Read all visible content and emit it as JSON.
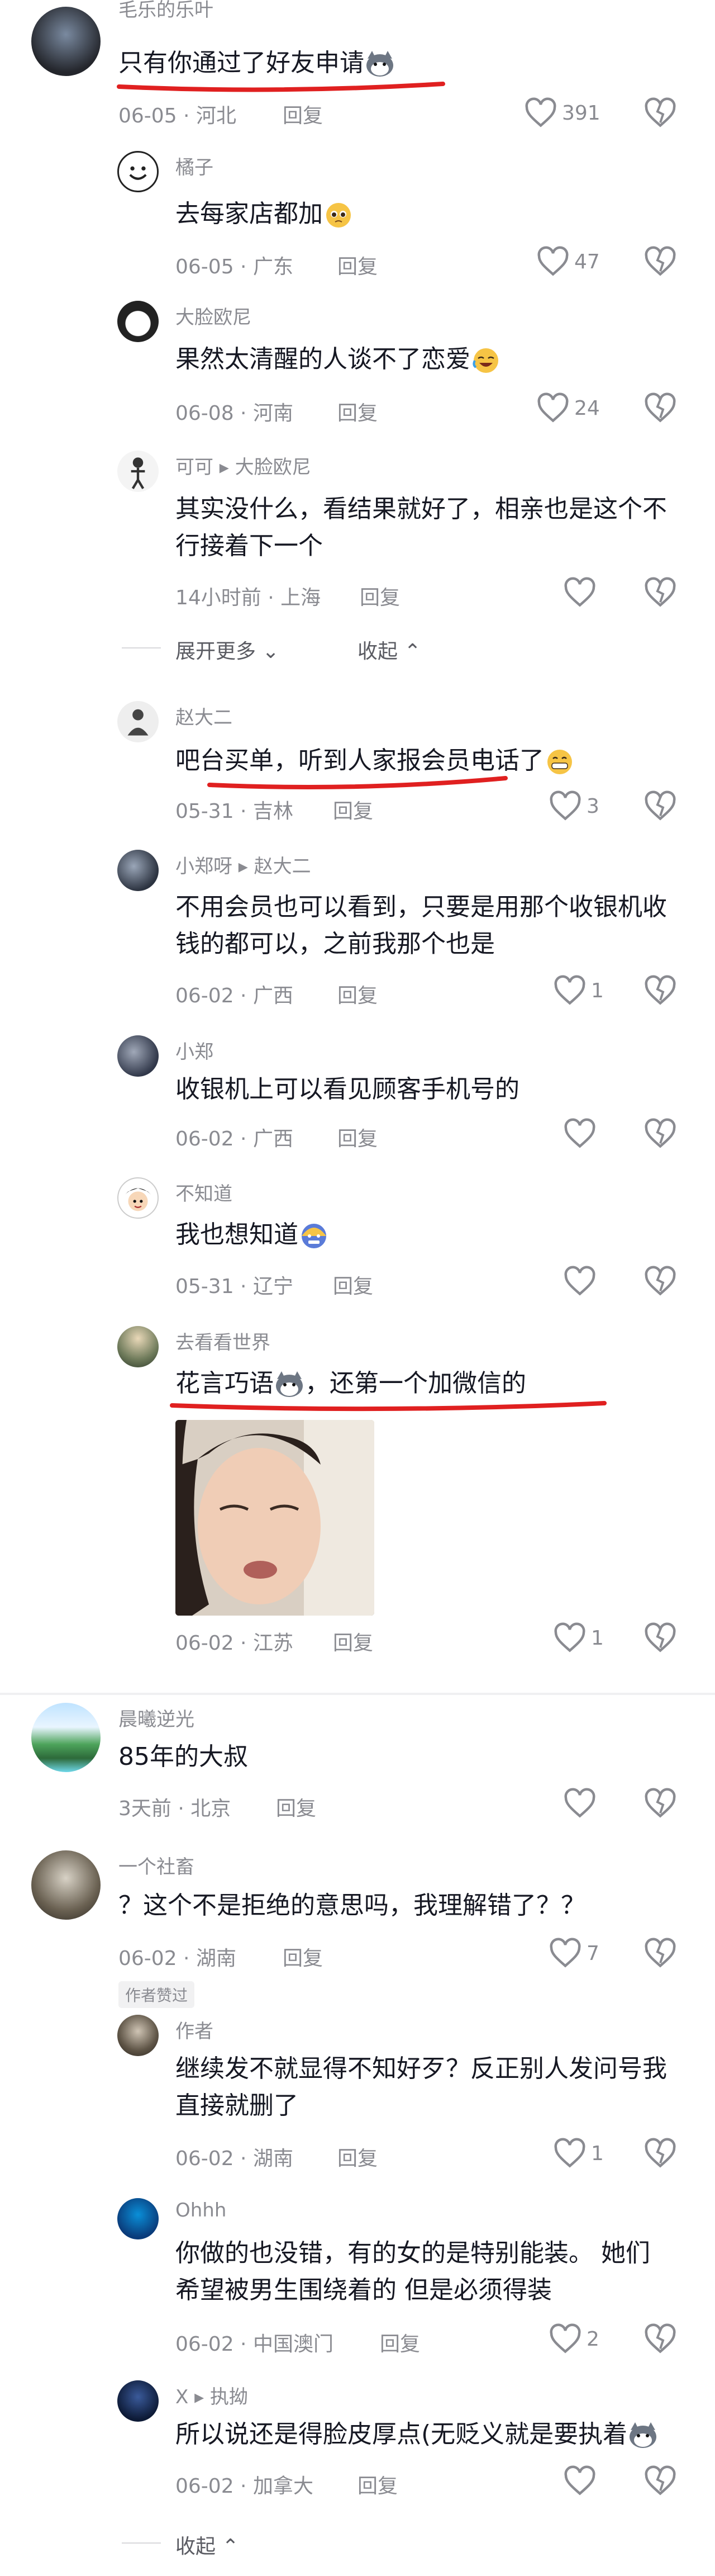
{
  "comments": [
    {
      "username": "毛乐的乐叶",
      "text": "只有你通过了好友申请",
      "date": "06-05",
      "location": "河北",
      "reply": "回复",
      "likes": "391"
    },
    {
      "username": "橘子",
      "text": "去每家店都加",
      "date": "06-05",
      "location": "广东",
      "reply": "回复",
      "likes": "47"
    },
    {
      "username": "大脸欧尼",
      "text": "果然太清醒的人谈不了恋爱",
      "date": "06-08",
      "location": "河南",
      "reply": "回复",
      "likes": "24"
    },
    {
      "username": "可可 ▸ 大脸欧尼",
      "text_line1": "其实没什么，看结果就好了，相亲也是这个不",
      "text_line2": "行接着下一个",
      "date": "14小时前",
      "location": "上海",
      "reply": "回复"
    },
    {
      "username": "赵大二",
      "text": "吧台买单，听到人家报会员电话了",
      "date": "05-31",
      "location": "吉林",
      "reply": "回复",
      "likes": "3"
    },
    {
      "username": "小郑呀 ▸ 赵大二",
      "text_line1": "不用会员也可以看到，只要是用那个收银机收",
      "text_line2": "钱的都可以，之前我那个也是",
      "date": "06-02",
      "location": "广西",
      "reply": "回复",
      "likes": "1"
    },
    {
      "username": "小郑",
      "text": "收银机上可以看见顾客手机号的",
      "date": "06-02",
      "location": "广西",
      "reply": "回复"
    },
    {
      "username": "不知道",
      "text": "我也想知道",
      "date": "05-31",
      "location": "辽宁",
      "reply": "回复"
    },
    {
      "username": "去看看世界",
      "text_a": "花言巧语",
      "text_b": "，还第一个加微信的",
      "date": "06-02",
      "location": "江苏",
      "reply": "回复",
      "likes": "1"
    },
    {
      "username": "晨曦逆光",
      "text": "85年的大叔",
      "date": "3天前",
      "location": "北京",
      "reply": "回复"
    },
    {
      "username": "一个社畜",
      "text": "？这个不是拒绝的意思吗，我理解错了？？",
      "date": "06-02",
      "location": "湖南",
      "reply": "回复",
      "likes": "7",
      "badge": "作者赞过"
    },
    {
      "username": "作者",
      "text_line1": "继续发不就显得不知好歹？反正别人发问号我",
      "text_line2": "直接就删了",
      "date": "06-02",
      "location": "湖南",
      "reply": "回复",
      "likes": "1"
    },
    {
      "username": "Ohhh",
      "text_line1": "你做的也没错，有的女的是特别能装。 她们",
      "text_line2": "希望被男生围绕着的 但是必须得装",
      "date": "06-02",
      "location": "中国澳门",
      "reply": "回复",
      "likes": "2"
    },
    {
      "username": "X ▸ 执拗",
      "text": "所以说还是得脸皮厚点(无贬义就是要执着",
      "date": "06-02",
      "location": "加拿大",
      "reply": "回复"
    }
  ],
  "expanders": {
    "more": "展开更多",
    "collapse1": "收起",
    "collapse2": "收起"
  },
  "colors": {
    "underline": "#e02020",
    "text": "#161823",
    "meta": "#8a8b91"
  }
}
